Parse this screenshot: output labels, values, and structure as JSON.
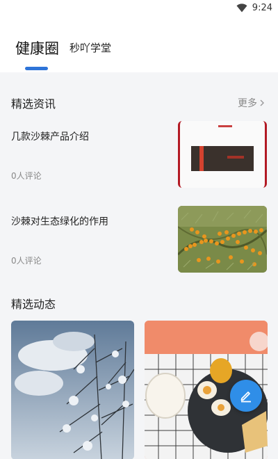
{
  "status_bar": {
    "time": "9:24",
    "wifi_icon": "wifi-icon"
  },
  "tabs": [
    {
      "label": "健康圈",
      "active": true
    },
    {
      "label": "秒吖学堂",
      "active": false
    }
  ],
  "accent_color": "#2e74d8",
  "news_section": {
    "title": "精选资讯",
    "more_label": "更多",
    "items": [
      {
        "title": "几款沙棘产品介绍",
        "meta": "0人评论"
      },
      {
        "title": "沙棘对生态绿化的作用",
        "meta": "0人评论"
      }
    ]
  },
  "feed_section": {
    "title": "精选动态"
  },
  "fab": {
    "icon": "edit-icon",
    "color": "#2f8ee8"
  }
}
